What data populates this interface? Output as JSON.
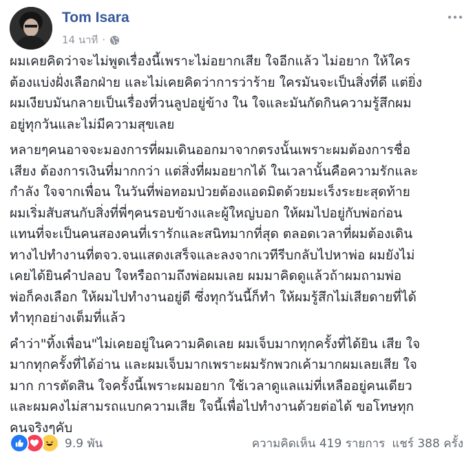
{
  "post": {
    "author": "Tom Isara",
    "time": "14 นาที",
    "separator": "·",
    "paragraphs": [
      [
        "ผมเคยคิดว่าจะไม่พูดเรื่องนี้เพราะไม่อยากเสีย ใจอีกแล้ว ไม่อยาก ให้ใคร",
        "ต้องแบ่งฝั่งเลือกฝ่าย และไม่เคยคิดว่าการว่าร้าย ใครมันจะเป็นสิ่งที่ดี แต่ยิ่ง",
        "ผมเงียบมันกลายเป็นเรื่องที่วนลูปอยู่ข้าง ใน ใจและมันกัดกินความรู้สึกผม",
        "อยู่ทุกวันและไม่มีความสุขเลย"
      ],
      [
        "หลายๆคนอาจจะมองการที่ผมเดินออกมาจากตรงนั้นเพราะผมต้องการชื่อ",
        "เสียง ต้องการเงินที่มากกว่า แต่สิ่งที่ผมอยากได้ ในเวลานั้นคือความรักและ",
        "กำลัง ใจจากเพื่อน ในวันที่พ่อทอมป่วยต้องแอดมิตด้วยมะเร็งระยะสุดท้าย",
        "ผมเริ่มสับสนกับสิ่งที่พี่ๆคนรอบข้างและผู้ใหญ่บอก ให้ผมไปอยู่กับพ่อก่อน",
        "แทนที่จะเป็นคนสองคนที่เรารักและสนิทมากที่สุด ตลอดเวลาที่ผมต้องเดิน",
        "ทางไปทำงานที่ตจว.จนแสดงเสร็จและลงจากเวทีรีบกลับไปหาพ่อ ผมยังไม่",
        "เคยได้ยินคำปลอบ ใจหรือถามถึงพ่อผมเลย ผมมาคิดดูแล้วถ้าผมถามพ่อ",
        "พ่อก็คงเลือก ให้ผมไปทำงานอยู่ดี ซึ่งทุกวันนี้ก็ทำ ให้ผมรู้สึกไม่เสียดายที่ได้",
        "ทำทุกอย่างเต็มที่แล้ว"
      ],
      [
        "คำว่า\"ทิ้งเพื่อน\"ไม่เคยอยู่ในความคิดเลย ผมเจ็บมากทุกครั้งที่ได้ยิน เสีย ใจ",
        "มากทุกครั้งที่ได้อ่าน และผมเจ็บมากเพราะผมรักพวกเค้ามากผมเลยเสีย ใจ",
        "มาก การตัดสิน ใจครั้งนี้เพราะผมอยาก ใช้เวลาดูแลแม่ที่เหลืออยู่คนเดียว",
        "และผมคงไม่สามรถแบกความเสีย ใจนี้เพื่อไปทำงานด้วยต่อได้ ขอโทษทุก",
        "คนจริงๆคับ"
      ]
    ],
    "reaction_count": "9.9 พัน",
    "comments": "ความคิดเห็น 419 รายการ",
    "shares": "แชร์ 388 ครั้ง",
    "colors": {
      "author": "#365899",
      "meta": "#90949c",
      "text": "#1d2129",
      "like": "#2078f4",
      "love": "#f33e58",
      "haha": "#fbcd4d"
    }
  }
}
